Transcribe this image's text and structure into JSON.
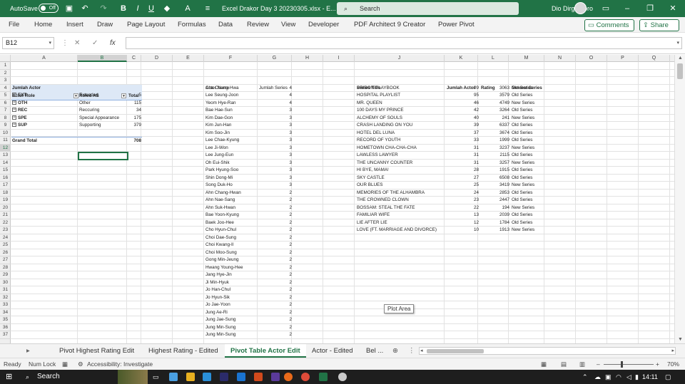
{
  "titlebar": {
    "autosave_label": "AutoSave",
    "autosave_state": "Off",
    "file_title": "Excel Drakor Day 3 20230305.xlsx - E...",
    "search_placeholder": "Search",
    "user_name": "Dio Dirgantoro"
  },
  "menu": {
    "items": [
      "File",
      "Home",
      "Insert",
      "Draw",
      "Page Layout",
      "Formulas",
      "Data",
      "Review",
      "View",
      "Developer",
      "PDF Architect 9 Creator",
      "Power Pivot"
    ],
    "comments_label": "Comments",
    "share_label": "Share"
  },
  "formula_bar": {
    "name_box": "B12",
    "fx_label": "fx",
    "formula": ""
  },
  "columns": [
    "A",
    "B",
    "C",
    "D",
    "E",
    "F",
    "G",
    "H",
    "I",
    "J",
    "K",
    "L",
    "M",
    "N",
    "O",
    "P",
    "Q"
  ],
  "rows": [
    "1",
    "2",
    "3",
    "4",
    "5",
    "6",
    "7",
    "8",
    "9",
    "10",
    "11",
    "12",
    "13",
    "14",
    "15",
    "16",
    "17",
    "18",
    "19",
    "20",
    "21",
    "22",
    "23",
    "24",
    "25",
    "26",
    "27",
    "28",
    "29",
    "30",
    "31",
    "32",
    "33",
    "34",
    "35",
    "36",
    "37"
  ],
  "pivot": {
    "title": "Jumlah Actor",
    "header_actor_role": "Actor Role",
    "header_roled_as": "Roled AS",
    "header_total": "Total",
    "rows": [
      {
        "code": "EXT",
        "role": "Extended",
        "total": "5"
      },
      {
        "code": "OTH",
        "role": "Other",
        "total": "115"
      },
      {
        "code": "REC",
        "role": "Reccuring",
        "total": "34"
      },
      {
        "code": "SPE",
        "role": "Special Appearance",
        "total": "175"
      },
      {
        "code": "SUP",
        "role": "Supporting",
        "total": "379"
      }
    ],
    "grand_total_label": "Grand Total",
    "grand_total": "708"
  },
  "actors": {
    "header_name": "Actor Name",
    "header_count": "Jumlah Series",
    "rows": [
      [
        "Cha Chung-Hwa",
        "4"
      ],
      [
        "Lee Seung-Joon",
        "4"
      ],
      [
        "Yeom Hye-Ran",
        "4"
      ],
      [
        "Bae Hae-Sun",
        "3"
      ],
      [
        "Kim Dae-Gon",
        "3"
      ],
      [
        "Kim Jun-Han",
        "3"
      ],
      [
        "Kim Soo-Jin",
        "3"
      ],
      [
        "Lee Chae-Kyung",
        "3"
      ],
      [
        "Lee Ji-Won",
        "3"
      ],
      [
        "Lee Jung-Eun",
        "3"
      ],
      [
        "Oh Eui-Shik",
        "3"
      ],
      [
        "Park Hyung-Soo",
        "3"
      ],
      [
        "Shin Dong-Mi",
        "3"
      ],
      [
        "Song Duk-Ho",
        "3"
      ],
      [
        "Ahn Chang-Hwan",
        "2"
      ],
      [
        "Ahn Nae-Sang",
        "2"
      ],
      [
        "Ahn Suk-Hwan",
        "2"
      ],
      [
        "Bae Yoon-Kyung",
        "2"
      ],
      [
        "Baek Joo-Hee",
        "2"
      ],
      [
        "Cho Hyun-Chul",
        "2"
      ],
      [
        "Choi Dae-Sung",
        "2"
      ],
      [
        "Choi Kwang-Il",
        "2"
      ],
      [
        "Choi Moo-Sung",
        "2"
      ],
      [
        "Gong Min-Jeung",
        "2"
      ],
      [
        "Hwang Young-Hee",
        "2"
      ],
      [
        "Jang Hye-Jin",
        "2"
      ],
      [
        "Ji Min-Hyuk",
        "2"
      ],
      [
        "Jo Han-Chul",
        "2"
      ],
      [
        "Jo Hyun-Sik",
        "2"
      ],
      [
        "Jo Jae-Yoon",
        "2"
      ],
      [
        "Jung Ae-Ri",
        "2"
      ],
      [
        "Jung Jae-Sung",
        "2"
      ],
      [
        "Jung Min-Sung",
        "2"
      ],
      [
        "Jung Min-Sung",
        "2"
      ]
    ]
  },
  "series": {
    "header_title": "Series Title",
    "header_count": "Jumlah Actor",
    "header_rating": "Rating",
    "header_newest": "Newest Series",
    "rows": [
      [
        "PRISON PLAYBOOK",
        "99",
        "3063",
        "Old Series"
      ],
      [
        "HOSPITAL PLAYLIST",
        "95",
        "3579",
        "Old Series"
      ],
      [
        "MR. QUEEN",
        "46",
        "4749",
        "New Series"
      ],
      [
        "100 DAYS MY PRINCE",
        "42",
        "3264",
        "Old Series"
      ],
      [
        "ALCHEMY OF SOULS",
        "40",
        "241",
        "New Series"
      ],
      [
        "CRASH LANDING ON YOU",
        "39",
        "6337",
        "Old Series"
      ],
      [
        "HOTEL DEL LUNA",
        "37",
        "3674",
        "Old Series"
      ],
      [
        "RECORD OF YOUTH",
        "33",
        "1999",
        "Old Series"
      ],
      [
        "HOMETOWN CHA-CHA-CHA",
        "31",
        "3237",
        "New Series"
      ],
      [
        "LAWLESS LAWYER",
        "31",
        "2115",
        "Old Series"
      ],
      [
        "THE UNCANNY COUNTER",
        "31",
        "3257",
        "New Series"
      ],
      [
        "HI BYE, MAMA!",
        "28",
        "1915",
        "Old Series"
      ],
      [
        "SKY CASTLE",
        "27",
        "6508",
        "Old Series"
      ],
      [
        "OUR BLUES",
        "25",
        "3419",
        "New Series"
      ],
      [
        "MEMORIES OF THE ALHAMBRA",
        "24",
        "2853",
        "Old Series"
      ],
      [
        "THE CROWNED CLOWN",
        "23",
        "2447",
        "Old Series"
      ],
      [
        "BOSSAM: STEAL THE FATE",
        "22",
        "194",
        "New Series"
      ],
      [
        "FAMILIAR WIFE",
        "13",
        "2039",
        "Old Series"
      ],
      [
        "LIE AFTER LIE",
        "12",
        "1784",
        "Old Series"
      ],
      [
        "LOVE (FT. MARRIAGE AND DIVORCE)",
        "10",
        "1913",
        "New Series"
      ]
    ]
  },
  "tooltip": "Plot Area",
  "sheet_tabs": [
    "Pivot Highest Rating Edit",
    "Highest Rating - Edited",
    "Pivot Table Actor Edit",
    "Actor - Edited",
    "Bel ..."
  ],
  "active_tab": "Pivot Table Actor Edit",
  "statusbar": {
    "ready": "Ready",
    "numlock": "Num Lock",
    "accessibility": "Accessibility: Investigate",
    "zoom": "70%"
  },
  "taskbar": {
    "search": "Search",
    "time": "14:11"
  },
  "colors": {
    "excel_green": "#217346",
    "pivot_header": "#dde8f6"
  }
}
